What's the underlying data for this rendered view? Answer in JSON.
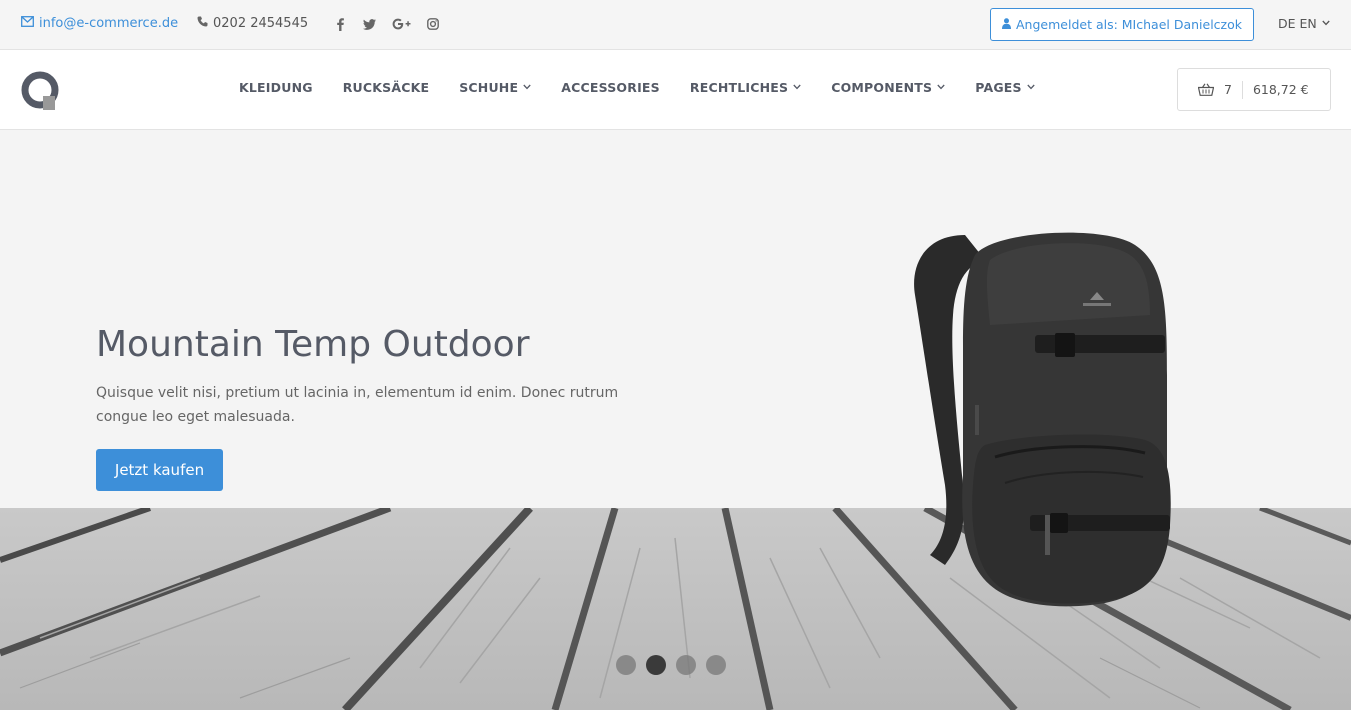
{
  "topbar": {
    "email": "info@e-commerce.de",
    "phone": "0202 2454545",
    "social_icons": [
      "facebook-icon",
      "twitter-icon",
      "google-plus-icon",
      "instagram-icon"
    ],
    "login_label": "Angemeldet als: MIchael Danielczok",
    "languages": [
      "DE",
      "EN"
    ]
  },
  "nav": {
    "items": [
      {
        "label": "KLEIDUNG",
        "dropdown": false
      },
      {
        "label": "RUCKSÄCKE",
        "dropdown": false
      },
      {
        "label": "SCHUHE",
        "dropdown": true
      },
      {
        "label": "ACCESSORIES",
        "dropdown": false
      },
      {
        "label": "RECHTLICHES",
        "dropdown": true
      },
      {
        "label": "COMPONENTS",
        "dropdown": true
      },
      {
        "label": "PAGES",
        "dropdown": true
      }
    ]
  },
  "cart": {
    "count": "7",
    "total": "618,72 €"
  },
  "hero": {
    "title": "Mountain Temp Outdoor",
    "text": "Quisque velit nisi, pretium ut lacinia in, elementum id enim. Donec rutrum congue leo eget malesuada.",
    "button_label": "Jetzt kaufen",
    "slides": 4,
    "active_slide": 2
  },
  "colors": {
    "accent": "#3d8fd9",
    "text": "#555a66",
    "topbar_bg": "#f5f5f5"
  }
}
